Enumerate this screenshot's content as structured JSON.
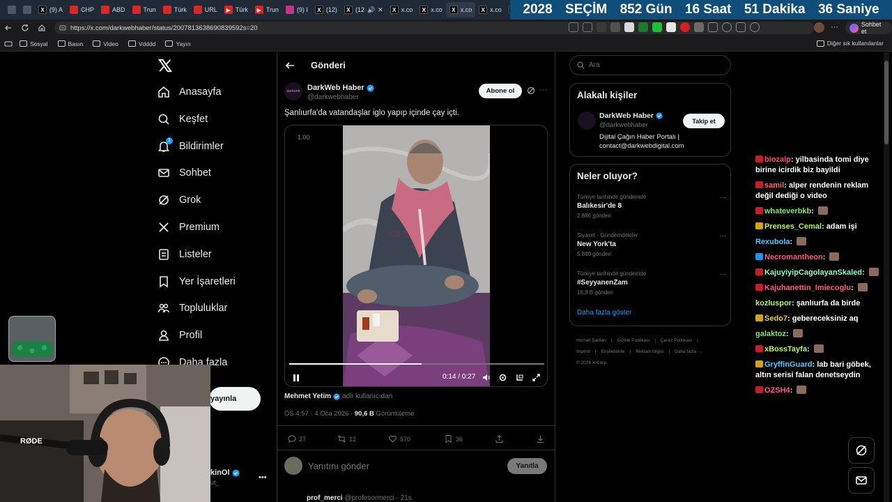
{
  "browser": {
    "tabs": [
      {
        "label": "",
        "icon": "workspaces-icon",
        "kind": "plain"
      },
      {
        "label": "",
        "icon": "tab-actions-icon",
        "kind": "plain"
      },
      {
        "label": "(9) A",
        "icon": "x-logo-icon",
        "kind": "x"
      },
      {
        "label": "CHP",
        "icon": "news-icon",
        "kind": "red"
      },
      {
        "label": "ABD",
        "icon": "news-icon",
        "kind": "red"
      },
      {
        "label": "Trun",
        "icon": "news-icon",
        "kind": "red"
      },
      {
        "label": "Türk",
        "icon": "news-icon",
        "kind": "red"
      },
      {
        "label": "URL",
        "icon": "news-icon",
        "kind": "red"
      },
      {
        "label": "Türk",
        "icon": "youtube-icon",
        "kind": "yt"
      },
      {
        "label": "Trun",
        "icon": "youtube-icon",
        "kind": "yt"
      },
      {
        "label": "(9) I",
        "icon": "instagram-icon",
        "kind": "ig"
      },
      {
        "label": "(12)",
        "icon": "x-logo-icon",
        "kind": "x"
      },
      {
        "label": "(12",
        "icon": "x-logo-icon",
        "kind": "x"
      },
      {
        "label": "x.co",
        "icon": "x-logo-icon",
        "kind": "x"
      },
      {
        "label": "x.co",
        "icon": "x-logo-icon",
        "kind": "x"
      },
      {
        "label": "x.co",
        "icon": "x-logo-icon",
        "kind": "x"
      },
      {
        "label": "x.co",
        "icon": "x-logo-icon",
        "kind": "x"
      },
      {
        "label": "x.co",
        "icon": "x-logo-icon",
        "kind": "x"
      },
      {
        "label": "Ligh",
        "icon": "page-icon",
        "kind": "plain"
      }
    ],
    "countdown": {
      "year": "2028",
      "label": "SEÇİM",
      "days": "852 Gün",
      "hours": "16 Saat",
      "minutes": "51 Dakika",
      "seconds": "36 Saniye"
    },
    "url": "https://x.com/darkwebhaber/status/2007813638690839592s=20",
    "copilot_label": "Sohbet et",
    "bookmarks": [
      "Sosyal",
      "Basın",
      "Video",
      "Vdddd",
      "Yayın"
    ],
    "other_bookmarks": "Diğer sık kullanılanlar"
  },
  "nav": {
    "items": [
      {
        "label": "Anasayfa",
        "icon": "home-icon"
      },
      {
        "label": "Keşfet",
        "icon": "search-icon"
      },
      {
        "label": "Bildirimler",
        "icon": "bell-icon",
        "badge": "1"
      },
      {
        "label": "Sohbet",
        "icon": "mail-icon"
      },
      {
        "label": "Grok",
        "icon": "grok-icon"
      },
      {
        "label": "Premium",
        "icon": "x-premium-icon"
      },
      {
        "label": "Listeler",
        "icon": "list-icon"
      },
      {
        "label": "Yer İşaretleri",
        "icon": "bookmark-icon"
      },
      {
        "label": "Topluluklar",
        "icon": "communities-icon"
      },
      {
        "label": "Profil",
        "icon": "person-icon"
      },
      {
        "label": "Daha fazla",
        "icon": "more-circle-icon"
      }
    ],
    "post_button": "yayınla",
    "account_name": "kinOl",
    "account_handle": "ut_"
  },
  "post": {
    "header_title": "Gönderi",
    "author_name": "DarkWeb Haber",
    "author_handle": "@darkwebhaber",
    "avatar_text": "darkweb",
    "subscribe": "Abone ol",
    "text": "Şanlıurfa'da vatandaşlar iglo yapıp içinde çay içti.",
    "video": {
      "speed": "1.00",
      "time": "0:14 / 0:27",
      "progress": 0.52,
      "watermark": "KU S"
    },
    "tagged_name": "Mehmet Yetim",
    "tagged_suffix": "adlı kullanıcıdan",
    "time": "ÖS 4:57 · 4 Oca 2026 ·",
    "views": "90,6 B",
    "views_label": "Görüntüleme",
    "stats": {
      "replies": "27",
      "reposts": "12",
      "likes": "570",
      "bookmarks": "36"
    },
    "reply_placeholder": "Yanıtını gönder",
    "reply_button": "Yanıtla",
    "next_author": "prof_merci",
    "next_handle": "@profesormerci · 21s"
  },
  "right": {
    "search_placeholder": "Ara",
    "related_title": "Alakalı kişiler",
    "related": {
      "name": "DarkWeb Haber",
      "handle": "@darkwebhaber",
      "bio": "Dijital Çağın Haber Portalı | contact@darkwebdigital.com",
      "follow": "Takip et"
    },
    "trends_title": "Neler oluyor?",
    "trends": [
      {
        "context": "Türkiye tarihinde gündemde",
        "title": "Balıkesir'de 8",
        "count": "2.886 gönderi"
      },
      {
        "context": "Siyaset · Gündemdekiler",
        "title": "New York'ta",
        "count": "5.880 gönderi"
      },
      {
        "context": "Türkiye tarihinde gündemde",
        "title": "#SeyyanenZam",
        "count": "16,8 B gönderi"
      }
    ],
    "show_more": "Daha fazla göster",
    "footer": [
      "Hizmet Şartları",
      "|",
      "Gizlilik Politikası",
      "|",
      "Çerez Politikası",
      "|",
      "Imprint",
      "|",
      "Erişilebilirlik",
      "|",
      "Reklam bilgisi",
      "|",
      "Daha fazla ···",
      "© 2026 X Corp."
    ]
  },
  "chat": [
    {
      "user": "biozalp",
      "color": "#ff4d6a",
      "text": "yilbasinda tomi diye birine icirdik biz bayildi",
      "badge": "red"
    },
    {
      "user": "samil",
      "color": "#ff6b6b",
      "text": "alper rendenin reklam değil dediği o video",
      "badge": "red"
    },
    {
      "user": "whateverbkb",
      "color": "#7fe86a",
      "text": "",
      "badge": "red",
      "emote": true
    },
    {
      "user": "Prenses_Cemal",
      "color": "#b6f36a",
      "text": "adam işi",
      "badge": "gold"
    },
    {
      "user": "Rexubola",
      "color": "#56c8ff",
      "text": "",
      "badge": "",
      "emote": true
    },
    {
      "user": "Necromantheon",
      "color": "#ff5a8a",
      "text": "",
      "badge": "gem",
      "emote": true
    },
    {
      "user": "KajuyiyipCagolayanSkaled",
      "color": "#8affc1",
      "text": "",
      "badge": "red",
      "emote": true
    },
    {
      "user": "Kajuhanettin_Imiecoglu",
      "color": "#ff5a8a",
      "text": "",
      "badge": "red",
      "emote": true
    },
    {
      "user": "kozluspor",
      "color": "#b6f36a",
      "text": "şanlıurfa da birde",
      "badge": ""
    },
    {
      "user": "Sedo7",
      "color": "#e8d24a",
      "text": "gebereceksiniz aq",
      "badge": "gold"
    },
    {
      "user": "galaktoz",
      "color": "#7fe86a",
      "text": "",
      "badge": "",
      "emote": true
    },
    {
      "user": "xBossTayfa",
      "color": "#b6f36a",
      "text": "",
      "badge": "red",
      "emote": true
    },
    {
      "user": "GryffinGuard",
      "color": "#56c8ff",
      "text": "lab bari göbek, altın serisi falan denetseydin",
      "badge": "gold"
    },
    {
      "user": "OZSH4",
      "color": "#ff5a8a",
      "text": "",
      "badge": "red",
      "emote": true
    }
  ],
  "webcam": {
    "mic_brand": "RØDE"
  }
}
